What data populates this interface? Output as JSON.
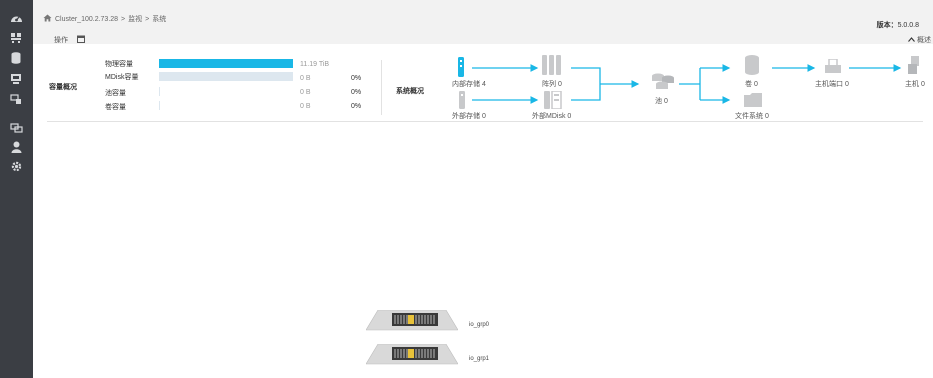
{
  "sidebar": {
    "icons": [
      "dashboard-icon",
      "monitor-icon",
      "storage-pool-icon",
      "volumes-icon",
      "hosts-icon",
      "copy-services-icon",
      "access-icon",
      "settings-icon"
    ]
  },
  "header": {
    "breadcrumb": [
      "Cluster_100.2.73.28",
      "监视",
      "系统"
    ],
    "separator": ">",
    "version_label": "版本：",
    "version_value": "5.0.0.8",
    "ops_label": "操作",
    "collapse_label": "概述"
  },
  "capacity": {
    "section_label": "容量概况",
    "rows": [
      {
        "label": "物理容量",
        "value": "11.19 TiB",
        "percent": "",
        "fill": 1.0,
        "color": "#19b7e6"
      },
      {
        "label": "MDisk容量",
        "value": "0 B",
        "percent": "0%",
        "fill": 1.0,
        "color": "#dde7ef"
      },
      {
        "label": "池容量",
        "value": "0 B",
        "percent": "0%",
        "fill": 0.0,
        "color": "#dde7ef"
      },
      {
        "label": "卷容量",
        "value": "0 B",
        "percent": "0%",
        "fill": 0.0,
        "color": "#dde7ef"
      }
    ]
  },
  "system_overview": {
    "section_label": "系统概况",
    "nodes": {
      "internal_storage": "内部存储 4",
      "arrays": "阵列 0",
      "external_storage": "外部存储 0",
      "external_mdisk": "外部MDisk 0",
      "pools": "池 0",
      "volumes": "卷 0",
      "file_systems": "文件系统 0",
      "host_ports": "主机端口 0",
      "hosts": "主机 0"
    },
    "accent_color": "#19b7e6"
  },
  "io_groups": [
    {
      "label": "io_grp0"
    },
    {
      "label": "io_grp1"
    }
  ]
}
